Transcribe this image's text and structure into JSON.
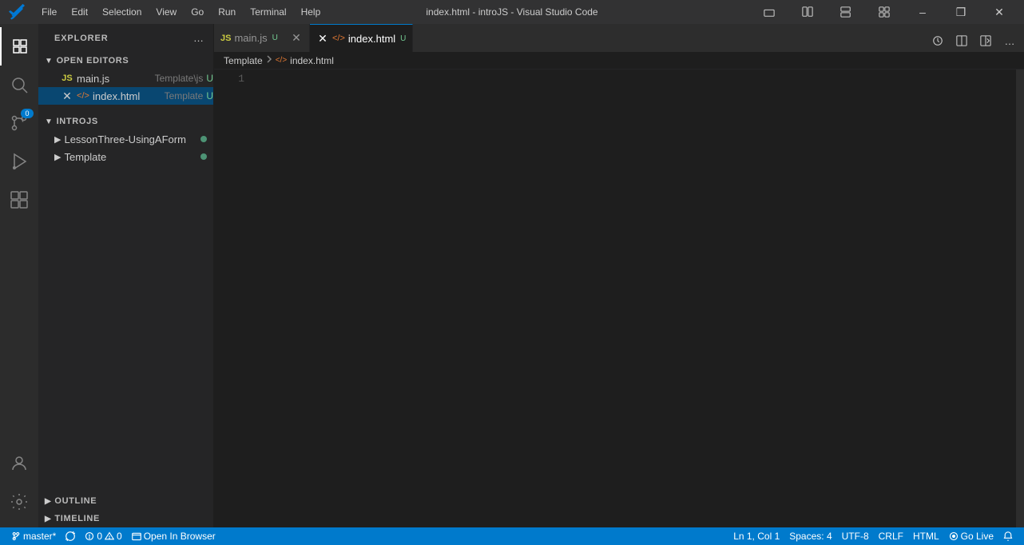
{
  "window": {
    "title": "index.html - introJS - Visual Studio Code"
  },
  "menu": {
    "items": [
      "File",
      "Edit",
      "Selection",
      "View",
      "Go",
      "Run",
      "Terminal",
      "Help"
    ]
  },
  "titlebar": {
    "buttons": [
      "minimize",
      "restore",
      "close"
    ]
  },
  "sidebar": {
    "header": "Explorer",
    "sections": {
      "open_editors": {
        "label": "Open Editors",
        "files": [
          {
            "icon": "JS",
            "name": "main.js",
            "path": "Template\\js",
            "badge": "U"
          },
          {
            "icon": "HTML",
            "name": "index.html",
            "path": "Template",
            "badge": "U",
            "active": true
          }
        ]
      },
      "introjs": {
        "label": "IntroJS",
        "folders": [
          {
            "name": "LessonThree-UsingAForm",
            "hasChanges": true
          },
          {
            "name": "Template",
            "hasChanges": true
          }
        ]
      },
      "outline": {
        "label": "Outline"
      },
      "timeline": {
        "label": "Timeline"
      }
    }
  },
  "tabs": [
    {
      "icon": "JS",
      "name": "main.js",
      "unsaved": "U",
      "active": false
    },
    {
      "icon": "HTML",
      "name": "index.html",
      "unsaved": "U",
      "active": true
    }
  ],
  "breadcrumb": {
    "folder": "Template",
    "separator": ">",
    "file": "index.html"
  },
  "editor": {
    "line_number": "1",
    "content": ""
  },
  "statusbar": {
    "branch": "master*",
    "sync_icon": "sync",
    "errors": "0",
    "warnings": "0",
    "open_in_browser": "Open In Browser",
    "position": "Ln 1, Col 1",
    "spaces": "Spaces: 4",
    "encoding": "UTF-8",
    "line_ending": "CRLF",
    "language": "HTML",
    "live": "Go Live",
    "notifications": "0"
  }
}
